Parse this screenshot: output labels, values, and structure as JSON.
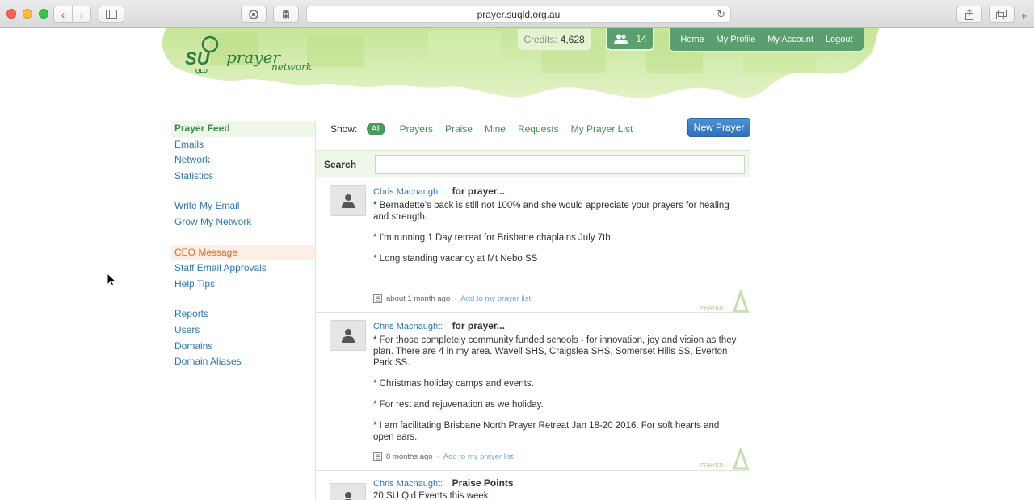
{
  "browser": {
    "url": "prayer.suqld.org.au"
  },
  "header": {
    "logo_text": "prayer network",
    "logo_su": "SU",
    "logo_qld": "QLD",
    "credits_label": "Credits:",
    "credits_value": "4,628",
    "friends_count": "14",
    "nav": [
      "Home",
      "My Profile",
      "My Account",
      "Logout"
    ]
  },
  "sidebar": {
    "group1": [
      "Prayer Feed",
      "Emails",
      "Network",
      "Statistics"
    ],
    "group2": [
      "Write My Email",
      "Grow My Network"
    ],
    "group3": [
      "CEO Message",
      "Staff Email Approvals",
      "Help Tips"
    ],
    "group4": [
      "Reports",
      "Users",
      "Domains",
      "Domain Aliases"
    ]
  },
  "filters": {
    "label": "Show:",
    "options": [
      "All",
      "Prayers",
      "Praise",
      "Mine",
      "Requests",
      "My Prayer List"
    ],
    "new_prayer": "New Prayer"
  },
  "search": {
    "label": "Search",
    "value": ""
  },
  "posts": [
    {
      "author": "Chris Macnaught:",
      "title": "for prayer...",
      "lines": [
        "* Bernadette's back is still not 100% and she would appreciate your prayers for healing and strength.",
        "* I'm running 1 Day retreat for Brisbane chaplains July 7th.",
        "* Long standing vacancy at Mt Nebo SS"
      ],
      "time": "about 1 month ago",
      "action": "Add to my prayer list",
      "mark": "PRAYER"
    },
    {
      "author": "Chris Macnaught:",
      "title": "for prayer...",
      "lines": [
        "* For those completely community funded schools - for innovation, joy and vision as they plan. There are 4 in my area. Wavell SHS, Craigslea SHS, Somerset Hills SS, Everton Park SS.",
        "* Christmas holiday camps and events.",
        "* For rest and rejuvenation as we holiday.",
        "* I am facilitating Brisbane North Prayer Retreat Jan 18-20 2016.  For soft hearts and open ears."
      ],
      "time": "8 months ago",
      "action": "Add to my prayer list",
      "mark": "PRAYER"
    },
    {
      "author": "Chris Macnaught:",
      "title": "Praise Points",
      "lines": [
        "20 SU Qld Events this week."
      ]
    }
  ],
  "colors": {
    "accent_green": "#5a9f6d",
    "link_blue": "#2f77b6",
    "highlight_orange": "#e06a2b",
    "button_blue": "#3a80c8"
  }
}
